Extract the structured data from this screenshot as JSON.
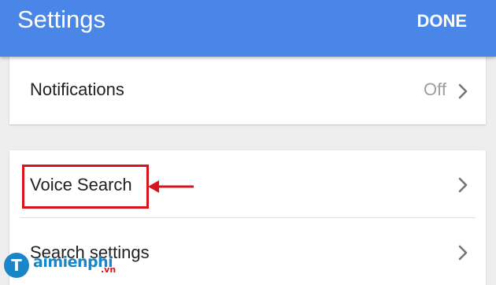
{
  "appbar": {
    "title": "Settings",
    "done_label": "DONE",
    "color": "#4a86e8"
  },
  "settings": {
    "notifications": {
      "label": "Notifications",
      "value": "Off",
      "icon": "chevron-right-icon"
    },
    "voice_search": {
      "label": "Voice Search",
      "icon": "chevron-right-icon"
    },
    "search_settings": {
      "label": "Search settings",
      "icon": "chevron-right-icon"
    }
  },
  "annotation": {
    "highlight_color": "#d7141c",
    "arrow_icon": "left-arrow-icon"
  },
  "watermark": {
    "text": "aimienphi",
    "suffix": ".vn",
    "logo_letter": "T"
  }
}
